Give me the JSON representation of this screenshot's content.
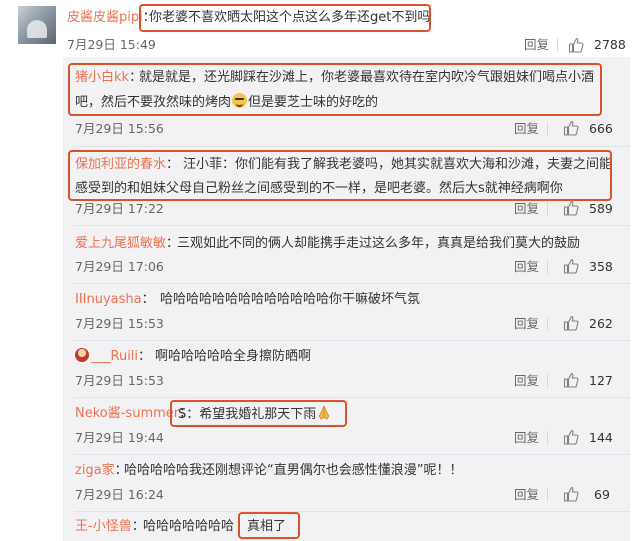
{
  "main_comment": {
    "username": "皮酱皮酱pipi",
    "text": "你老婆不喜欢晒太阳这个点这么多年还get不到吗",
    "time": "7月29日 15:49",
    "reply_label": "回复",
    "likes": "2788"
  },
  "replies": [
    {
      "username": "猪小白kk",
      "text1": "就是就是，还光脚踩在沙滩上，你老婆最喜欢待在室内吹冷气跟姐妹们喝点小酒",
      "text2a": "吧，然后不要孜然味的烤肉",
      "text2b": "但是要芝士味的好吃的",
      "time": "7月29日 15:56",
      "reply_label": "回复",
      "likes": "666"
    },
    {
      "username": "保加利亚的春水",
      "text1": "汪小菲：你们能有我了解我老婆吗，她其实就喜欢大海和沙滩，夫妻之间能",
      "text2": "感受到的和姐妹父母自己粉丝之间感受到的不一样，是吧老婆。然后大s就神经病啊你",
      "time": "7月29日 17:22",
      "reply_label": "回复",
      "likes": "589"
    },
    {
      "username": "爱上九尾狐敏敏",
      "text": "三观如此不同的俩人却能携手走过这么多年，真真是给我们莫大的鼓励",
      "time": "7月29日 17:06",
      "reply_label": "回复",
      "likes": "358"
    },
    {
      "username": "IIInuyasha",
      "text": "哈哈哈哈哈哈哈哈哈哈哈哈哈你干嘛破坏气氛",
      "time": "7月29日 15:53",
      "reply_label": "回复",
      "likes": "262"
    },
    {
      "username": "___Ruili",
      "text": "啊哈哈哈哈哈全身擦防晒啊",
      "time": "7月29日 15:53",
      "reply_label": "回复",
      "likes": "127"
    },
    {
      "username": "Neko酱-summer",
      "text": "S：希望我婚礼那天下雨",
      "time": "7月29日 19:44",
      "reply_label": "回复",
      "likes": "144"
    },
    {
      "username": "ziga家",
      "text": "哈哈哈哈哈我还刚想评论“直男偶尔也会感性懂浪漫”呢！！",
      "time": "7月29日 16:24",
      "reply_label": "回复",
      "likes": "69"
    },
    {
      "username": "王-小怪兽",
      "text_a": "哈哈哈哈哈哈哈",
      "text_b": "真相了"
    }
  ],
  "colon": "：",
  "icons": {
    "like": "thumbs-up-icon",
    "emoji": "laughing-tears-emoji-icon",
    "pray": "praying-hands-emoji-icon"
  },
  "colors": {
    "username": "#eb7350",
    "highlight": "#d9532b",
    "reply_bg": "#f2f2f5"
  }
}
